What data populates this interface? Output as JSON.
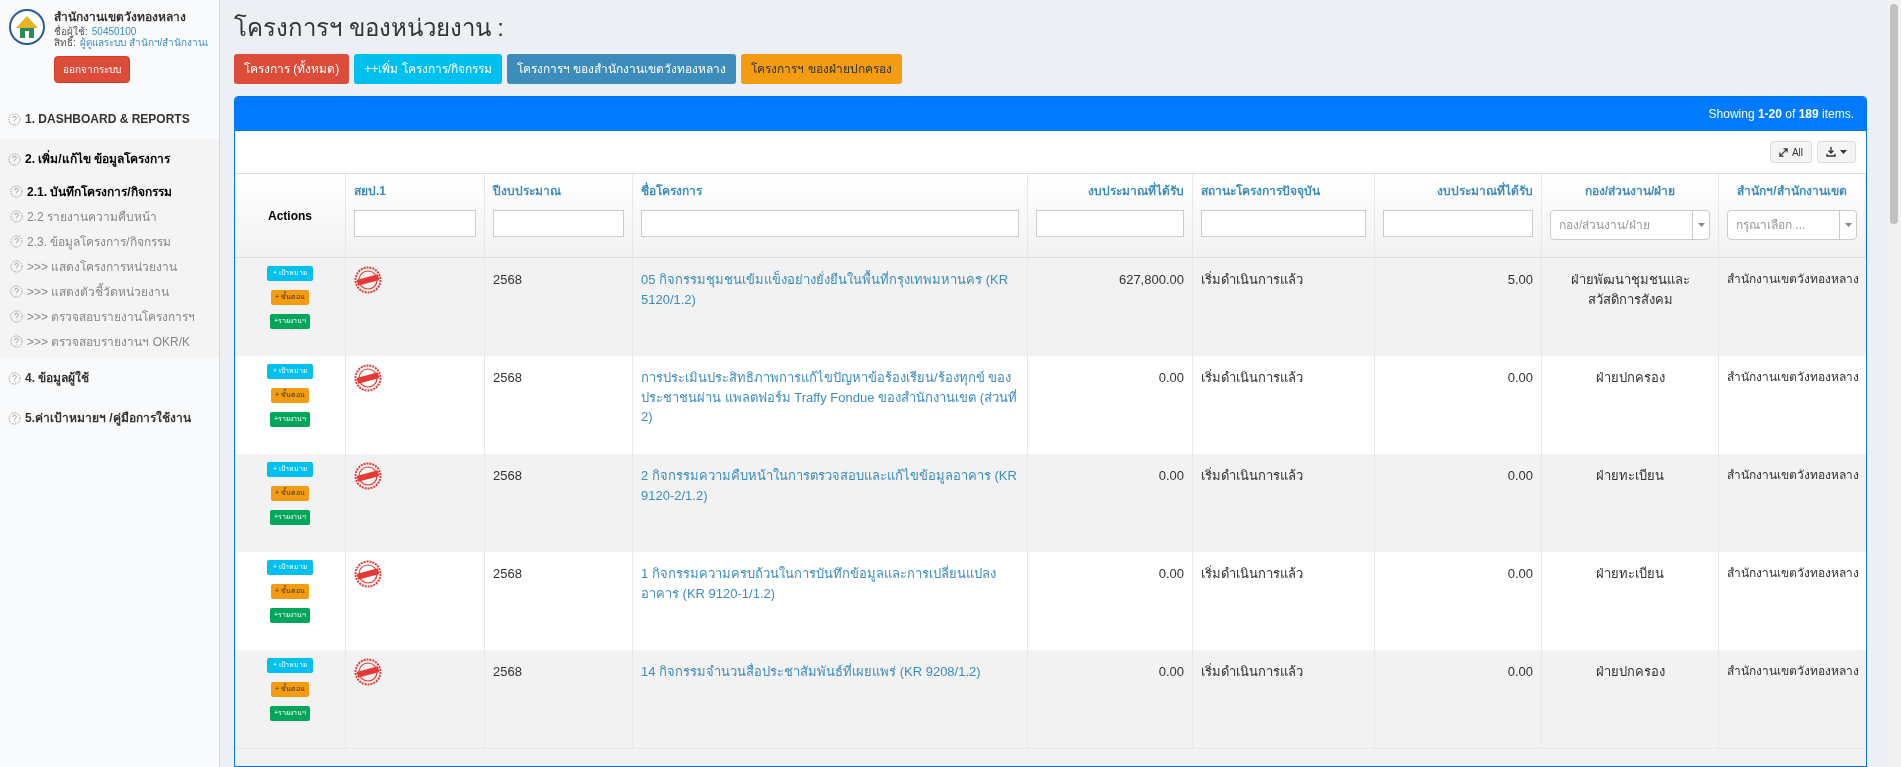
{
  "sidebar": {
    "org_name": "สำนักงานเขตวังทองหลาง",
    "user_label": "ชื่อผู้ใช้:",
    "user_value": "50450100",
    "rights_label": "สิทธิ์:",
    "rights_value": "ผู้ดูแลระบบ สำนักฯ/สำนักงานเ",
    "logout": "ออกจากระบบ",
    "menu": [
      {
        "label": "1. DASHBOARD & REPORTS",
        "expanded": false
      },
      {
        "label": "2. เพิ่ม/แก้ไข ข้อมูลโครงการ",
        "expanded": true,
        "children": [
          {
            "label": "2.1. บันทึกโครงการ/กิจกรรม",
            "selected": true
          },
          {
            "label": "2.2 รายงานความคืบหน้า",
            "selected": false
          },
          {
            "label": "2.3. ข้อมูลโครงการ/กิจกรรม",
            "selected": false
          },
          {
            "label": ">>> แสดงโครงการหน่วยงาน",
            "selected": false
          },
          {
            "label": ">>> แสดงตัวชี้วัดหน่วยงาน",
            "selected": false
          },
          {
            "label": ">>> ตรวจสอบรายงานโครงการฯ",
            "selected": false
          },
          {
            "label": ">>> ตรวจสอบรายงานฯ OKR/K",
            "selected": false
          }
        ]
      },
      {
        "label": "4. ข้อมูลผู้ใช้",
        "expanded": false
      },
      {
        "label": "5.ค่าเป้าหมายฯ /คู่มือการใช้งาน",
        "expanded": false
      }
    ]
  },
  "page_title": "โครงการฯ ของหน่วยงาน :",
  "buttons": [
    {
      "label": "โครงการ (ทั้งหมด)",
      "color": "#dd4b39"
    },
    {
      "label": "++เพิ่ม โครงการ/กิจกรรม",
      "color": "#00c0ef"
    },
    {
      "label": "โครงการฯ ของสำนักงานเขตวังทองหลาง",
      "color": "#3c8dbc"
    },
    {
      "label": "โครงการฯ ของฝ่ายปกครอง",
      "color": "#f39c12"
    }
  ],
  "panel": {
    "summary": "Showing **1-20** of **189** items.",
    "expand_button": "All",
    "columns": [
      {
        "label": "Actions",
        "kind": "plain"
      },
      {
        "label": "สยป.1",
        "kind": "sort",
        "filter": {
          "kind": "text"
        }
      },
      {
        "label": "ปีงบประมาณ",
        "kind": "sort",
        "filter": {
          "kind": "text"
        }
      },
      {
        "label": "ชื่อโครงการ",
        "kind": "sort",
        "filter": {
          "kind": "text"
        }
      },
      {
        "label": "งบประมาณที่ได้รับ",
        "kind": "sort",
        "filter": {
          "kind": "text"
        }
      },
      {
        "label": "สถานะโครงการปัจจุบัน",
        "kind": "sort",
        "filter": {
          "kind": "text"
        }
      },
      {
        "label": "งบประมาณที่ได้รับ",
        "kind": "sort",
        "filter": {
          "kind": "text"
        }
      },
      {
        "label": "กอง/ส่วนงาน/ฝ่าย",
        "kind": "sort",
        "filter": {
          "kind": "select",
          "placeholder": "กอง/ส่วนงาน/ฝ่าย"
        }
      },
      {
        "label": "สำนักฯ/สำนักงานเขต",
        "kind": "sort",
        "filter": {
          "kind": "select",
          "placeholder": "กรุณาเลือก ..."
        }
      }
    ],
    "rows": [
      {
        "actions": [
          "+ เป้าหมาย",
          "+ ขั้นตอน",
          "+รายงานฯ"
        ],
        "year": "2568",
        "name": "05 กิจกรรมชุมชนเข้มแข็งอย่างยั่งยืนในพื้นที่กรุงเทพมหานคร (KR 5120/1.2)",
        "budget": "627,800.00",
        "status": "เริ่มดำเนินการแล้ว",
        "budget_2": "5.00",
        "division": "ฝ่ายพัฒนาชุมชนและสวัสดิการสังคม",
        "office": "สำนักงานเขตวังทองหลาง"
      },
      {
        "actions": [
          "+ เป้าหมาย",
          "+ ขั้นตอน",
          "+รายงานฯ"
        ],
        "year": "2568",
        "name": "การประเมินประสิทธิภาพการแก้ไขปัญหาข้อร้องเรียน/ร้องทุกข์ ของประชาชนผ่าน แพลตฟอร์ม Traffy Fondue ของสำนักงานเขต (ส่วนที่ 2)",
        "budget": "0.00",
        "status": "เริ่มดำเนินการแล้ว",
        "budget_2": "0.00",
        "division": "ฝ่ายปกครอง",
        "office": "สำนักงานเขตวังทองหลาง"
      },
      {
        "actions": [
          "+ เป้าหมาย",
          "+ ขั้นตอน",
          "+รายงานฯ"
        ],
        "year": "2568",
        "name": "2 กิจกรรมความคืบหน้าในการตรวจสอบและแก้ไขข้อมูลอาคาร (KR 9120-2/1.2)",
        "budget": "0.00",
        "status": "เริ่มดำเนินการแล้ว",
        "budget_2": "0.00",
        "division": "ฝ่ายทะเบียน",
        "office": "สำนักงานเขตวังทองหลาง"
      },
      {
        "actions": [
          "+ เป้าหมาย",
          "+ ขั้นตอน",
          "+รายงานฯ"
        ],
        "year": "2568",
        "name": "1 กิจกรรมความครบถ้วนในการบันทึกข้อมูลและการเปลี่ยนแปลงอาคาร (KR 9120-1/1.2)",
        "budget": "0.00",
        "status": "เริ่มดำเนินการแล้ว",
        "budget_2": "0.00",
        "division": "ฝ่ายทะเบียน",
        "office": "สำนักงานเขตวังทองหลาง"
      },
      {
        "actions": [
          "+ เป้าหมาย",
          "+ ขั้นตอน",
          "+รายงานฯ"
        ],
        "year": "2568",
        "name": "14 กิจกรรมจำนวนสื่อประชาสัมพันธ์ที่เผยแพร่ (KR 9208/1.2)",
        "budget": "0.00",
        "status": "เริ่มดำเนินการแล้ว",
        "budget_2": "0.00",
        "division": "ฝ่ายปกครอง",
        "office": "สำนักงานเขตวังทองหลาง"
      }
    ]
  }
}
